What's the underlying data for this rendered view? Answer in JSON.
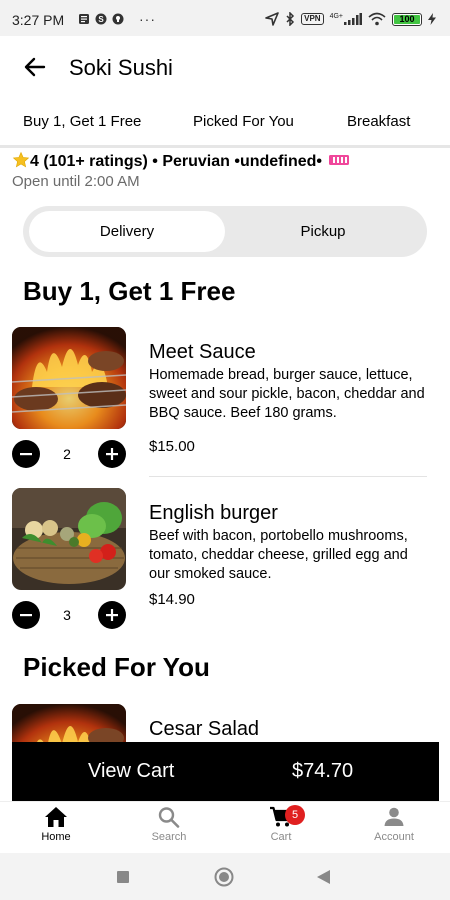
{
  "status_bar": {
    "time": "3:27 PM",
    "vpn": "VPN",
    "network": "4G+",
    "battery": "100"
  },
  "header": {
    "title": "Soki Sushi"
  },
  "category_tabs": [
    "Buy 1, Get 1 Free",
    "Picked For You",
    "Breakfast"
  ],
  "restaurant": {
    "rating_text": "4 (101+ ratings) • Peruvian •undefined•",
    "hours": "Open until 2:00 AM"
  },
  "order_mode": {
    "options": [
      "Delivery",
      "Pickup"
    ],
    "selected": "Delivery"
  },
  "sections": [
    {
      "title": "Buy 1, Get 1 Free",
      "items": [
        {
          "name": "Meet  Sauce",
          "description": "Homemade bread, burger sauce, lettuce, sweet and sour pickle, bacon, cheddar and BBQ sauce. Beef 180 grams.",
          "price": "$15.00",
          "quantity": "2"
        },
        {
          "name": "English burger",
          "description": "Beef with bacon, portobello mushrooms, tomato, cheddar cheese, grilled egg and our smoked sauce.",
          "price": "$14.90",
          "quantity": "3"
        }
      ]
    },
    {
      "title": "Picked For You",
      "items": [
        {
          "name": "Cesar Salad"
        }
      ]
    }
  ],
  "cart_bar": {
    "label": "View Cart",
    "total": "$74.70"
  },
  "bottom_nav": {
    "items": [
      "Home",
      "Search",
      "Cart",
      "Account"
    ],
    "active": "Home",
    "cart_badge": "5"
  },
  "colors": {
    "accent": "#000000",
    "badge": "#e02020",
    "toggle_bg": "#e9e9e9"
  }
}
